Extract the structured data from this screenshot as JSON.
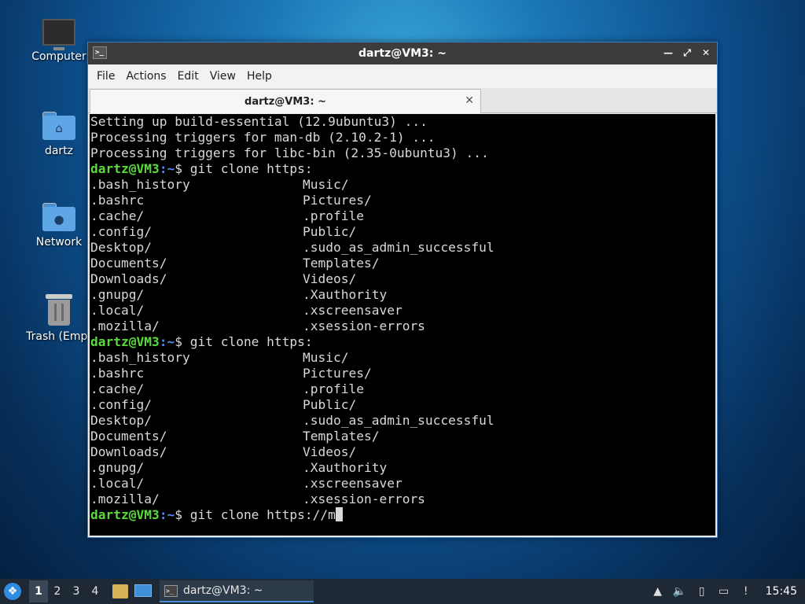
{
  "desktop": {
    "icons": [
      {
        "label": "Computer"
      },
      {
        "label": "dartz"
      },
      {
        "label": "Network"
      },
      {
        "label": "Trash (Empt"
      }
    ]
  },
  "window": {
    "title": "dartz@VM3: ~",
    "menu": [
      "File",
      "Actions",
      "Edit",
      "View",
      "Help"
    ],
    "tab_title": "dartz@VM3: ~"
  },
  "terminal": {
    "lines": [
      "Setting up build-essential (12.9ubuntu3) ...",
      "Processing triggers for man-db (2.10.2-1) ...",
      "Processing triggers for libc-bin (2.35-0ubuntu3) ..."
    ],
    "prompt_user": "dartz@VM3",
    "prompt_path": ":~",
    "prompt_sym": "$ ",
    "commands": [
      "git clone https:",
      "git clone https:",
      "git clone https://m"
    ],
    "listing": [
      [
        ".bash_history",
        "Music/"
      ],
      [
        ".bashrc",
        "Pictures/"
      ],
      [
        ".cache/",
        ".profile"
      ],
      [
        ".config/",
        "Public/"
      ],
      [
        "Desktop/",
        ".sudo_as_admin_successful"
      ],
      [
        "Documents/",
        "Templates/"
      ],
      [
        "Downloads/",
        "Videos/"
      ],
      [
        ".gnupg/",
        ".Xauthority"
      ],
      [
        ".local/",
        ".xscreensaver"
      ],
      [
        ".mozilla/",
        ".xsession-errors"
      ]
    ]
  },
  "taskbar": {
    "workspaces": [
      "1",
      "2",
      "3",
      "4"
    ],
    "active_workspace": "1",
    "task_label": "dartz@VM3: ~",
    "clock": "15:45"
  },
  "colors": {
    "prompt_user": "#5ada3b",
    "prompt_path": "#5b8bf2",
    "terminal_bg": "#000000"
  }
}
